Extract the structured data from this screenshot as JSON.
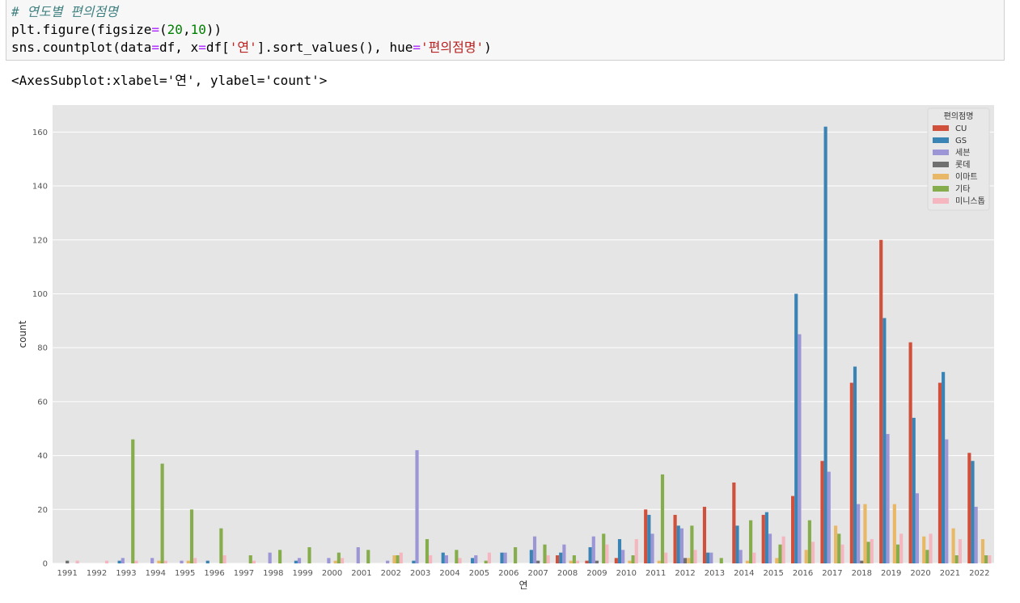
{
  "code": {
    "line1": "# 연도별 편의점명",
    "line2": {
      "a": "plt.figure(figsize",
      "b": "=",
      "c": "(",
      "d": "20",
      "e": ",",
      "f": "10",
      "g": "))"
    },
    "line3": {
      "a": "sns.countplot(data",
      "b": "=",
      "c": "df, x",
      "d": "=",
      "e": "df[",
      "f": "'연'",
      "g": "].sort_values(), hue",
      "h": "=",
      "i": "'편의점명'",
      "j": ")"
    }
  },
  "output_text": "<AxesSubplot:xlabel='연', ylabel='count'>",
  "chart_data": {
    "type": "bar",
    "xlabel": "연",
    "ylabel": "count",
    "ylim": [
      0,
      170
    ],
    "yticks": [
      0,
      20,
      40,
      60,
      80,
      100,
      120,
      140,
      160
    ],
    "grid": true,
    "legend_position": "top-right",
    "legend_title": "편의점명",
    "categories": [
      "1991",
      "1992",
      "1993",
      "1994",
      "1995",
      "1996",
      "1997",
      "1998",
      "1999",
      "2000",
      "2001",
      "2002",
      "2003",
      "2004",
      "2005",
      "2006",
      "2007",
      "2008",
      "2009",
      "2010",
      "2011",
      "2012",
      "2013",
      "2014",
      "2015",
      "2016",
      "2017",
      "2018",
      "2019",
      "2020",
      "2021",
      "2022"
    ],
    "series": [
      {
        "name": "CU",
        "color": "#d1503b",
        "values": [
          0,
          0,
          0,
          0,
          0,
          0,
          0,
          0,
          0,
          0,
          0,
          0,
          0,
          0,
          0,
          0,
          0,
          3,
          1,
          2,
          20,
          18,
          21,
          30,
          18,
          25,
          38,
          67,
          120,
          82,
          67,
          41
        ]
      },
      {
        "name": "GS",
        "color": "#3a84b5",
        "values": [
          0,
          0,
          1,
          0,
          0,
          1,
          0,
          0,
          1,
          0,
          0,
          0,
          1,
          4,
          2,
          4,
          5,
          4,
          6,
          9,
          18,
          14,
          4,
          14,
          19,
          100,
          162,
          73,
          91,
          54,
          71,
          38
        ]
      },
      {
        "name": "세븐",
        "color": "#9c95d6",
        "values": [
          0,
          0,
          2,
          2,
          1,
          0,
          0,
          4,
          2,
          2,
          6,
          1,
          42,
          3,
          3,
          4,
          10,
          7,
          10,
          5,
          11,
          13,
          4,
          5,
          11,
          85,
          34,
          22,
          48,
          26,
          46,
          21
        ]
      },
      {
        "name": "롯데",
        "color": "#707070",
        "values": [
          1,
          0,
          0,
          0,
          0,
          0,
          0,
          0,
          0,
          0,
          0,
          0,
          0,
          0,
          0,
          0,
          1,
          0,
          1,
          0,
          0,
          2,
          0,
          0,
          0,
          0,
          0,
          1,
          0,
          0,
          0,
          0
        ]
      },
      {
        "name": "이마트",
        "color": "#e9b866",
        "values": [
          0,
          0,
          0,
          1,
          1,
          0,
          0,
          0,
          0,
          1,
          0,
          3,
          0,
          0,
          0,
          0,
          0,
          1,
          0,
          1,
          1,
          2,
          0,
          1,
          2,
          5,
          14,
          22,
          22,
          10,
          13,
          9
        ]
      },
      {
        "name": "기타",
        "color": "#86ad4b",
        "values": [
          0,
          0,
          46,
          37,
          20,
          13,
          3,
          5,
          6,
          4,
          5,
          3,
          9,
          5,
          1,
          6,
          7,
          3,
          11,
          3,
          33,
          14,
          2,
          16,
          7,
          16,
          11,
          8,
          7,
          5,
          3,
          3
        ]
      },
      {
        "name": "미니스톱",
        "color": "#f5b6c0",
        "values": [
          1,
          1,
          1,
          1,
          2,
          3,
          1,
          0,
          0,
          2,
          0,
          4,
          3,
          2,
          4,
          0,
          3,
          1,
          7,
          9,
          4,
          5,
          0,
          4,
          10,
          8,
          7,
          9,
          11,
          11,
          9,
          3
        ]
      }
    ]
  }
}
